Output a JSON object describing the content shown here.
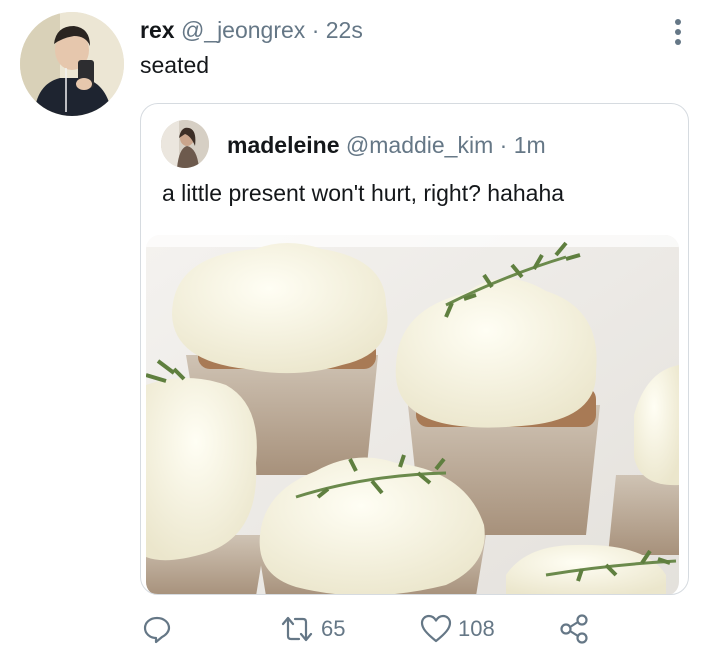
{
  "tweet": {
    "author_name": "rex",
    "author_handle": "@_jeongrex",
    "separator": "·",
    "time": "22s",
    "text": "seated",
    "more_icon": "more-vertical-icon"
  },
  "quoted_tweet": {
    "author_name": "madeleine",
    "author_handle": "@maddie_kim",
    "separator": "·",
    "time": "1m",
    "text": "a little present won't hurt, right? hahaha",
    "media_icon": "cupcakes-photo"
  },
  "actions": {
    "reply_icon": "reply-icon",
    "retweet_count": "65",
    "like_count": "108",
    "share_icon": "share-icon"
  },
  "colors": {
    "text": "#14171a",
    "muted": "#657786",
    "border": "#d6dbe0"
  }
}
